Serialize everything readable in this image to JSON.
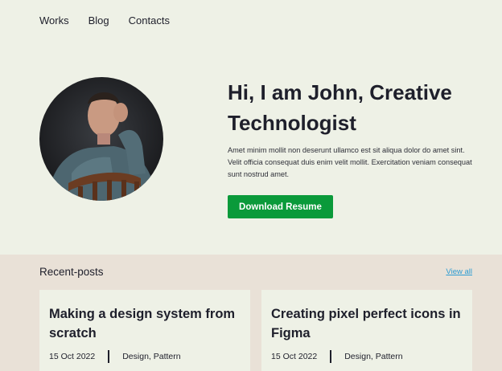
{
  "nav": {
    "items": [
      "Works",
      "Blog",
      "Contacts"
    ]
  },
  "hero": {
    "title": "Hi, I am John, Creative Technologist",
    "text": "Amet minim mollit non deserunt ullamco est sit aliqua dolor do amet sint. Velit officia consequat duis enim velit mollit. Exercitation veniam consequat sunt nostrud amet.",
    "button_label": "Download Resume"
  },
  "recent": {
    "heading": "Recent-posts",
    "view_all": "View all",
    "posts": [
      {
        "title": "Making a design system from scratch",
        "date": "15 Oct 2022",
        "tags": "Design, Pattern"
      },
      {
        "title": "Creating pixel perfect icons in Figma",
        "date": "15 Oct 2022",
        "tags": "Design, Pattern"
      }
    ]
  },
  "colors": {
    "hero_bg": "#eef1e6",
    "recent_bg": "#e9e1d7",
    "accent": "#0a9a3a",
    "link": "#2a9bd2"
  },
  "icons": [
    "profile-photo"
  ]
}
